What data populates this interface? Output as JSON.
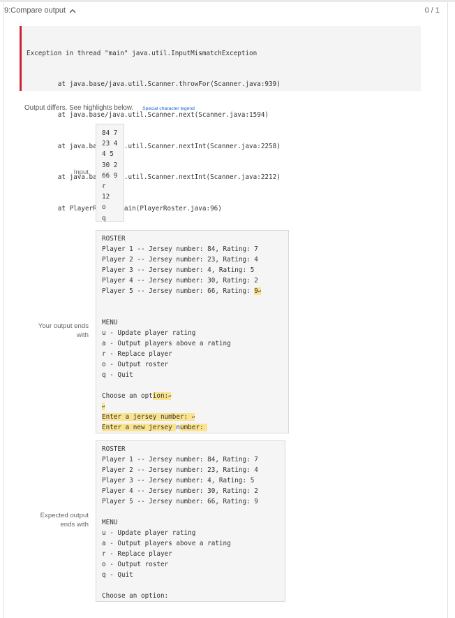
{
  "header": {
    "title": "9:Compare output",
    "score": "0 / 1"
  },
  "exception_lines": [
    "Exception in thread \"main\" java.util.InputMismatchException",
    "        at java.base/java.util.Scanner.throwFor(Scanner.java:939)",
    "        at java.base/java.util.Scanner.next(Scanner.java:1594)",
    "        at java.base/java.util.Scanner.nextInt(Scanner.java:2258)",
    "        at java.base/java.util.Scanner.nextInt(Scanner.java:2212)",
    "        at PlayerRoster.main(PlayerRoster.java:96)"
  ],
  "differs": {
    "message": "Output differs. See highlights below.",
    "legend_link": "Special character legend"
  },
  "labels": {
    "input": "Input",
    "your_output_1": "Your output ends",
    "your_output_2": "with",
    "expected_1": "Expected output",
    "expected_2": "ends with"
  },
  "input_lines": [
    "84 7",
    "23 4",
    "4 5",
    "30 2",
    "66 9",
    "r",
    "12",
    "o",
    "q"
  ],
  "your_output": {
    "roster_title": "ROSTER",
    "players": [
      "Player 1 -- Jersey number: 84, Rating: 7",
      "Player 2 -- Jersey number: 23, Rating: 4",
      "Player 3 -- Jersey number: 4, Rating: 5",
      "Player 4 -- Jersey number: 30, Rating: 2"
    ],
    "player5_prefix": "Player 5 -- Jersey number: 66, Rating: ",
    "player5_hl": "9",
    "menu_title": "MENU",
    "menu": [
      "u - Update player rating",
      "a - Output players above a rating",
      "r - Replace player",
      "o - Output roster",
      "q - Quit"
    ],
    "choose_prefix": "Choose an opt",
    "choose_hl": "ion:",
    "enter_jersey": "Enter a jersey number: ",
    "enter_new_a": "Enter a new jersey ",
    "enter_new_b": "n",
    "enter_new_c": "umber: "
  },
  "expected_output": {
    "roster_title": "ROSTER",
    "players": [
      "Player 1 -- Jersey number: 84, Rating: 7",
      "Player 2 -- Jersey number: 23, Rating: 4",
      "Player 3 -- Jersey number: 4, Rating: 5",
      "Player 4 -- Jersey number: 30, Rating: 2",
      "Player 5 -- Jersey number: 66, Rating: 9"
    ],
    "menu_title": "MENU",
    "menu": [
      "u - Update player rating",
      "a - Output players above a rating",
      "r - Replace player",
      "o - Output roster",
      "q - Quit"
    ],
    "choose": "Choose an option:"
  },
  "colors": {
    "highlight": "#fbe38f",
    "error_bar": "#cc2233",
    "link": "#1565c0"
  },
  "icons": {
    "collapse": "chevron-up-icon",
    "newline": "newline-symbol"
  }
}
